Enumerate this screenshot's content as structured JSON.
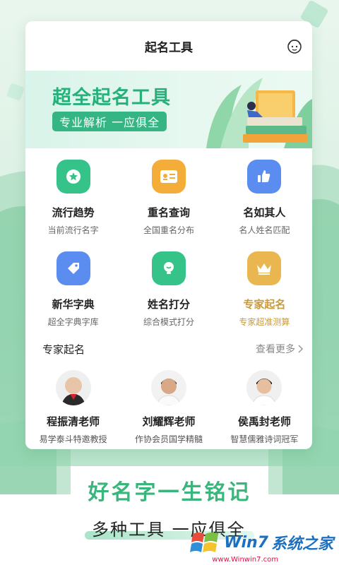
{
  "header": {
    "title": "起名工具",
    "profile_icon": "user-face-icon"
  },
  "banner": {
    "title": "超全起名工具",
    "tag": "专业解析  一应俱全"
  },
  "tools": [
    {
      "name": "流行趋势",
      "desc": "当前流行名字",
      "icon": "star-icon",
      "color": "#35c38a"
    },
    {
      "name": "重名查询",
      "desc": "全国重名分布",
      "icon": "id-card-icon",
      "color": "#f5ad3a"
    },
    {
      "name": "名如其人",
      "desc": "名人姓名匹配",
      "icon": "thumbs-up-icon",
      "color": "#5b8df0"
    },
    {
      "name": "新华字典",
      "desc": "超全字典字库",
      "icon": "tag-icon",
      "color": "#5b8df0"
    },
    {
      "name": "姓名打分",
      "desc": "综合模式打分",
      "icon": "bulb-icon",
      "color": "#35c38a"
    },
    {
      "name": "专家起名",
      "desc": "专家超准测算",
      "icon": "crown-icon",
      "color": "#e9b64f"
    }
  ],
  "experts_section": {
    "title": "专家起名",
    "more": "查看更多"
  },
  "experts": [
    {
      "name": "程振清老师",
      "desc": "易学泰斗特邀教授"
    },
    {
      "name": "刘耀辉老师",
      "desc": "作协会员国学精髓"
    },
    {
      "name": "侯禹封老师",
      "desc": "智慧儒雅诗词冠军"
    }
  ],
  "slogan": "好名字一生铭记",
  "subslogan": "多种工具 一应俱全",
  "watermark": {
    "brand": "系统之家",
    "logo_text": "Win7",
    "url": "www.Winwin7.com"
  }
}
